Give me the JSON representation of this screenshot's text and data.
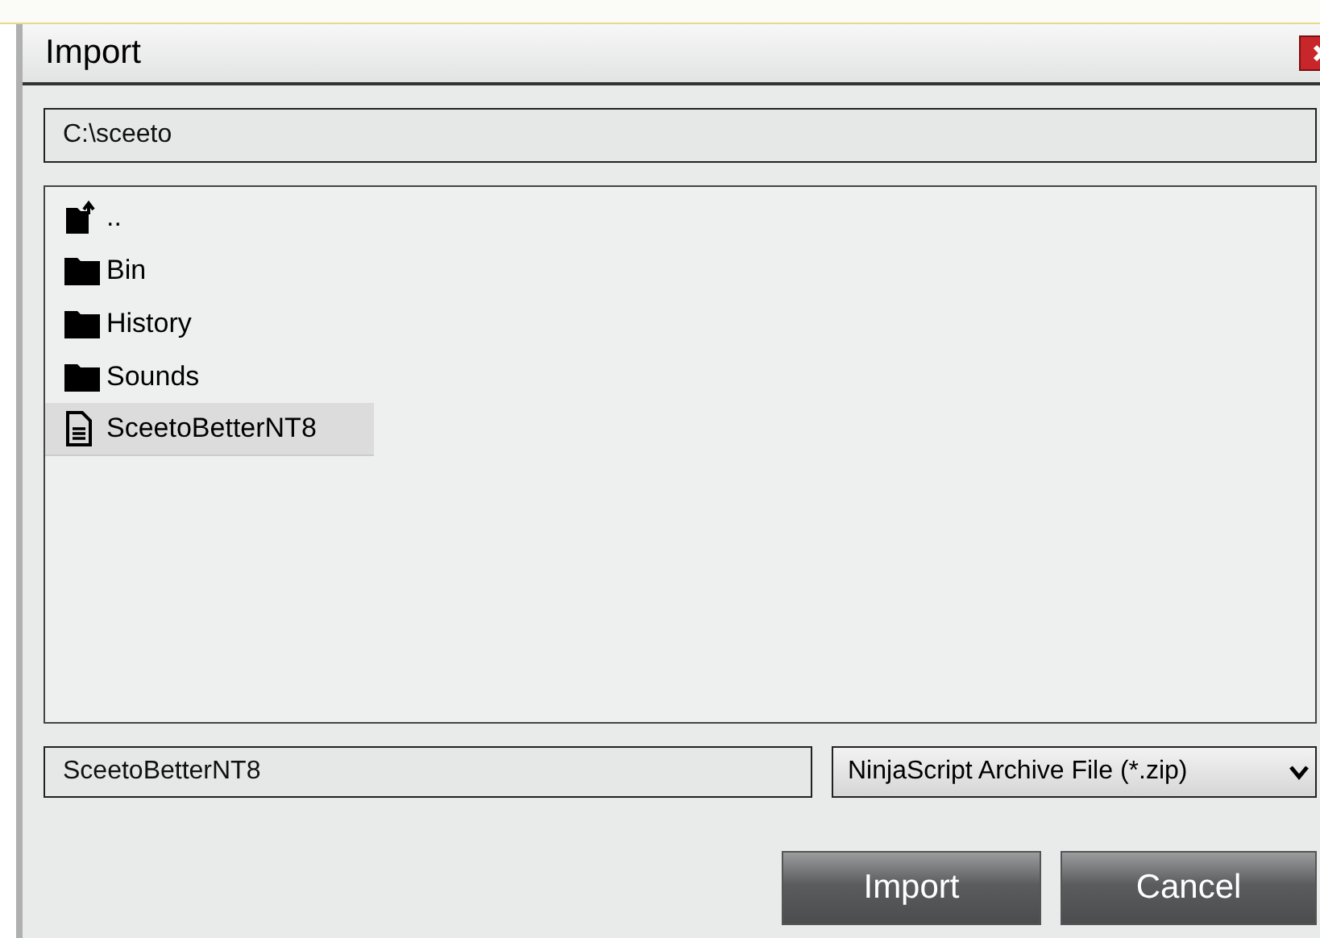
{
  "window": {
    "title": "Import"
  },
  "path": {
    "value": "C:\\sceeto"
  },
  "items": [
    {
      "kind": "up",
      "label": "..",
      "selected": false
    },
    {
      "kind": "folder",
      "label": "Bin",
      "selected": false
    },
    {
      "kind": "folder",
      "label": "History",
      "selected": false
    },
    {
      "kind": "folder",
      "label": "Sounds",
      "selected": false
    },
    {
      "kind": "file",
      "label": "SceetoBetterNT8",
      "selected": true
    }
  ],
  "file_name": {
    "value": "SceetoBetterNT8"
  },
  "file_type": {
    "value": "NinjaScript Archive File (*.zip)"
  },
  "buttons": [
    "Import",
    "Cancel"
  ]
}
